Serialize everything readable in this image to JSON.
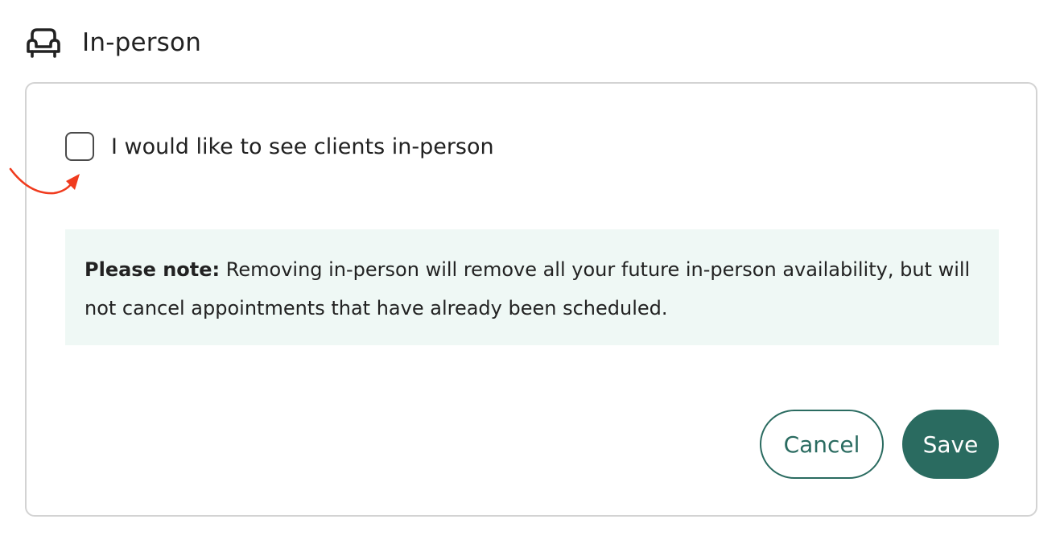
{
  "section": {
    "title": "In-person",
    "icon": "armchair-icon"
  },
  "checkbox": {
    "label": "I would like to see clients in-person",
    "checked": false
  },
  "note": {
    "label": "Please note:",
    "text": " Removing in-person will remove all your future in-person availability, but will not cancel appointments that have already been scheduled."
  },
  "actions": {
    "cancel_label": "Cancel",
    "save_label": "Save"
  },
  "colors": {
    "primary": "#2a6b60",
    "note_background": "#eff8f5",
    "border": "#d3d3d3",
    "annotation": "#f03b1e"
  }
}
